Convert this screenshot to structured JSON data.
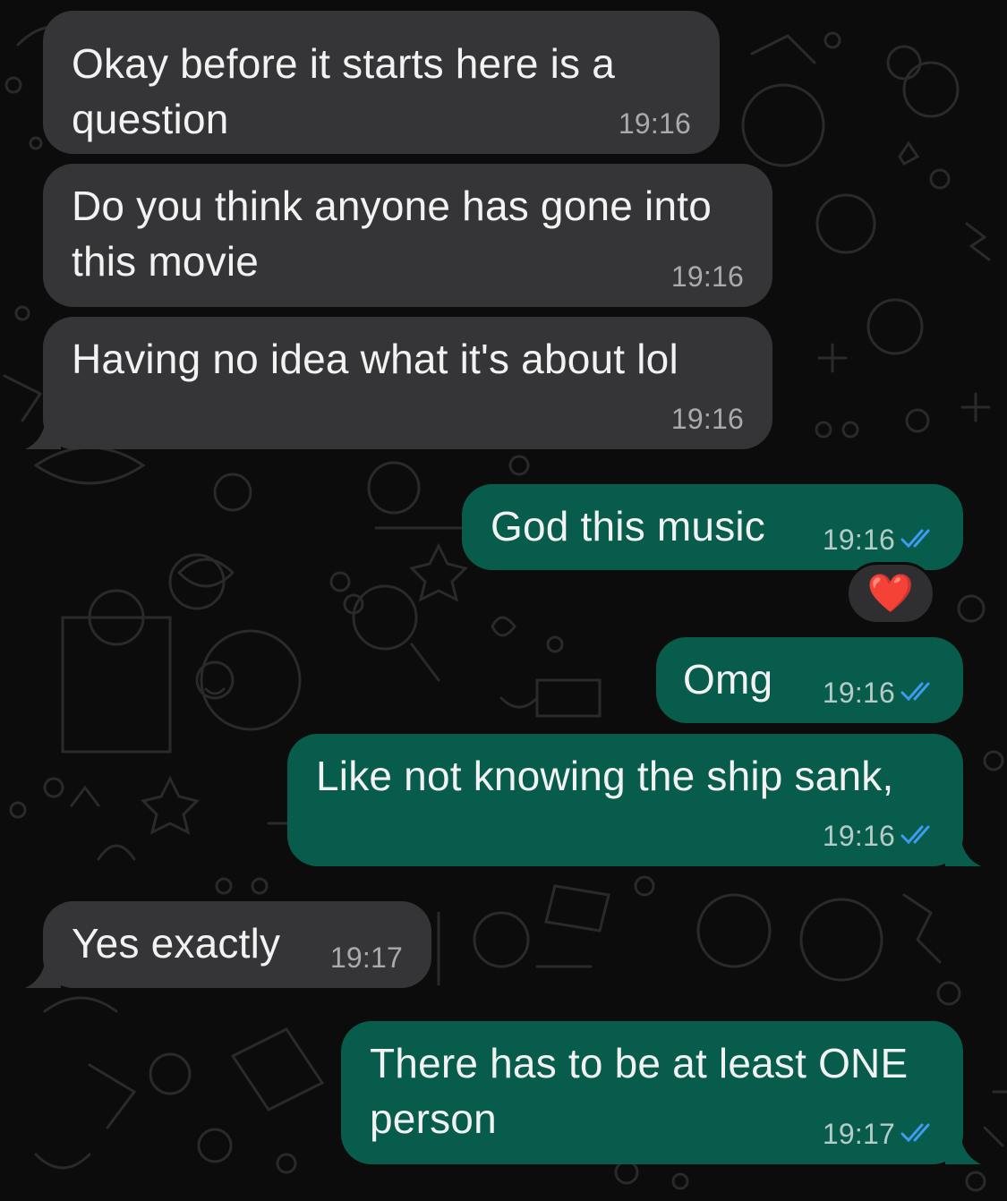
{
  "messages": [
    {
      "direction": "incoming",
      "text": "Okay before it starts here is a\nquestion",
      "time": "19:16"
    },
    {
      "direction": "incoming",
      "text": "Do you think anyone has gone into\nthis movie",
      "time": "19:16"
    },
    {
      "direction": "incoming",
      "text": "Having no idea what it's about lol",
      "time": "19:16"
    },
    {
      "direction": "outgoing",
      "text": "God this music",
      "time": "19:16",
      "status": "read",
      "reaction": "❤️"
    },
    {
      "direction": "outgoing",
      "text": "Omg",
      "time": "19:16",
      "status": "read"
    },
    {
      "direction": "outgoing",
      "text": "Like not knowing the ship sank,",
      "time": "19:16",
      "status": "read"
    },
    {
      "direction": "incoming",
      "text": "Yes exactly",
      "time": "19:17"
    },
    {
      "direction": "outgoing",
      "text": "There has to be at least ONE\nperson",
      "time": "19:17",
      "status": "read"
    }
  ],
  "colors": {
    "incoming_bubble": "#353537",
    "outgoing_bubble": "#075c4c",
    "read_ticks": "#3d9bf0",
    "background": "#0c0c0c"
  },
  "icons": {
    "read_status": "double-check-icon",
    "reaction": "heart-icon"
  }
}
